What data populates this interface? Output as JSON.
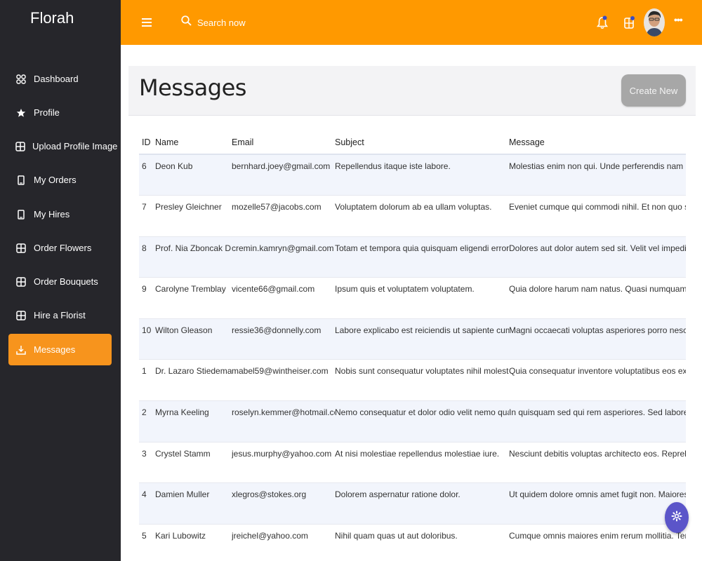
{
  "app": {
    "brand": "Florah"
  },
  "sidebar": {
    "items": [
      {
        "label": "Dashboard",
        "icon": "grid-icon",
        "active": false
      },
      {
        "label": "Profile",
        "icon": "star-icon",
        "active": false
      },
      {
        "label": "Upload Profile Image",
        "icon": "plus-box-icon",
        "active": false
      },
      {
        "label": "My Orders",
        "icon": "phone-icon",
        "active": false
      },
      {
        "label": "My Hires",
        "icon": "phone-icon",
        "active": false
      },
      {
        "label": "Order Flowers",
        "icon": "plus-box-icon",
        "active": false
      },
      {
        "label": "Order Bouquets",
        "icon": "plus-box-icon",
        "active": false
      },
      {
        "label": "Hire a Florist",
        "icon": "plus-box-icon",
        "active": false
      },
      {
        "label": "Messages",
        "icon": "download-icon",
        "active": true
      }
    ]
  },
  "topbar": {
    "search_placeholder": "Search now",
    "more_label": "•••"
  },
  "colors": {
    "accent": "#ff9900",
    "sidebar_bg": "#26262b",
    "active_item": "#f7941d",
    "button_gray": "#a7a7a7",
    "fab": "#5b55c9"
  },
  "page": {
    "title": "Messages",
    "create_button": "Create New"
  },
  "table": {
    "headers": {
      "id": "ID",
      "name": "Name",
      "email": "Email",
      "subject": "Subject",
      "message": "Message"
    },
    "rows": [
      {
        "id": "6",
        "name": "Deon Kub",
        "email": "bernhard.joey@gmail.com",
        "subject": "Repellendus itaque iste labore.",
        "message": "Molestias enim non qui. Unde perferendis nam laborio"
      },
      {
        "id": "7",
        "name": "Presley Gleichner",
        "email": "mozelle57@jacobs.com",
        "subject": "Voluptatem dolorum ab ea ullam voluptas.",
        "message": "Eveniet cumque qui commodi nihil. Et non quo sint lau"
      },
      {
        "id": "8",
        "name": "Prof. Nia Zboncak DDS",
        "email": "cremin.kamryn@gmail.com",
        "subject": "Totam et tempora quia quisquam eligendi error velit.",
        "message": "Dolores aut dolor autem sed sit. Velit vel impedit mag"
      },
      {
        "id": "9",
        "name": "Carolyne Tremblay",
        "email": "vicente66@gmail.com",
        "subject": "Ipsum quis et voluptatem voluptatem.",
        "message": "Quia dolore harum nam natus. Quasi numquam doloru"
      },
      {
        "id": "10",
        "name": "Wilton Gleason",
        "email": "ressie36@donnelly.com",
        "subject": "Labore explicabo est reiciendis ut sapiente cum.",
        "message": "Magni occaecati voluptas asperiores porro nesciunt sa"
      },
      {
        "id": "1",
        "name": "Dr. Lazaro Stiedemann",
        "email": "mabel59@wintheiser.com",
        "subject": "Nobis sunt consequatur voluptates nihil molestiae.",
        "message": "Quia consequatur inventore voluptatibus eos exceptur"
      },
      {
        "id": "2",
        "name": "Myrna Keeling",
        "email": "roselyn.kemmer@hotmail.com",
        "subject": "Nemo consequatur et dolor odio velit nemo quae.",
        "message": "In quisquam sed qui rem asperiores. Sed labore veniar"
      },
      {
        "id": "3",
        "name": "Crystel Stamm",
        "email": "jesus.murphy@yahoo.com",
        "subject": "At nisi molestiae repellendus molestiae iure.",
        "message": "Nesciunt debitis voluptas architecto eos. Reprehenderi"
      },
      {
        "id": "4",
        "name": "Damien Muller",
        "email": "xlegros@stokes.org",
        "subject": "Dolorem aspernatur ratione dolor.",
        "message": "Ut quidem dolore omnis amet fugit non. Maiores est ni"
      },
      {
        "id": "5",
        "name": "Kari Lubowitz",
        "email": "jreichel@yahoo.com",
        "subject": "Nihil quam quas ut aut doloribus.",
        "message": "Cumque omnis maiores enim rerum mollitia. Tenetur n"
      }
    ]
  }
}
